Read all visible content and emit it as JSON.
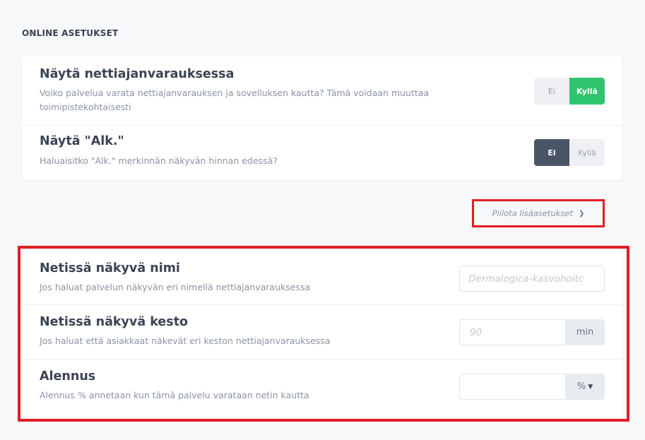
{
  "section": {
    "title": "ONLINE ASETUKSET"
  },
  "online_settings": [
    {
      "title": "Näytä nettiajanvarauksessa",
      "description": "Voiko palvelua varata nettiajanvarauksen ja sovelluksen kautta? Tämä voidaan muuttaa toimipistekohtaisesti",
      "toggle": {
        "no_label": "Ei",
        "yes_label": "Kyllä",
        "selected": "Kyllä"
      }
    },
    {
      "title": "Näytä \"Alk.\"",
      "description": "Haluaisitko \"Alk.\" merkinnän näkyvän hinnan edessä?",
      "toggle": {
        "no_label": "Ei",
        "yes_label": "Kyllä",
        "selected": "Ei"
      }
    }
  ],
  "advanced_toggle": {
    "label": "Piilota lisäasetukset",
    "icon": "chevron-down-icon"
  },
  "advanced_settings": {
    "online_name": {
      "title": "Netissä näkyvä nimi",
      "description": "Jos haluat palvelun näkyvän eri nimellä nettiajanvarauksessa",
      "placeholder": "Dermalogica-kasvohoitc"
    },
    "online_duration": {
      "title": "Netissä näkyvä kesto",
      "description": "Jos haluat että asiakkaat näkevät eri keston nettiajanvarauksessa",
      "placeholder": "90",
      "unit": "min"
    },
    "discount": {
      "title": "Alennus",
      "description": "Alennus % annetaan kun tämä palvelu varataan netin kautta",
      "value": "",
      "unit": "%"
    }
  },
  "colors": {
    "accent_green": "#2fc56e",
    "selected_dark": "#4a5568",
    "highlight_red": "#e21d24"
  }
}
